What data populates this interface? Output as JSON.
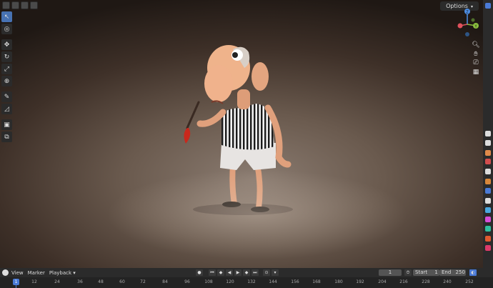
{
  "header": {
    "options_label": "Options"
  },
  "toolbar": {
    "tools": [
      "select-tool",
      "cursor-tool",
      "move-tool",
      "rotate-tool",
      "scale-tool",
      "transform-tool",
      "annotate-tool",
      "measure-tool",
      "add-cube-tool",
      "extrude-tool"
    ]
  },
  "gizmo": {
    "x_label": "",
    "y_label": "Y",
    "z_label": "Z"
  },
  "timeline": {
    "menus": [
      "View",
      "Marker",
      "Playback"
    ],
    "current_frame": "1",
    "start_label": "Start",
    "start_value": "1",
    "end_label": "End",
    "end_value": "250",
    "ruler_ticks": [
      "12",
      "24",
      "36",
      "48",
      "60",
      "72",
      "84",
      "96",
      "108",
      "120",
      "132",
      "144",
      "156",
      "168",
      "180",
      "192",
      "204",
      "216",
      "228",
      "240",
      "252"
    ],
    "playhead_frame": "1"
  },
  "colors": {
    "accent": "#4772b3",
    "x_axis": "#e0515c",
    "y_axis": "#8bbf3f",
    "z_axis": "#4d8ee5"
  }
}
